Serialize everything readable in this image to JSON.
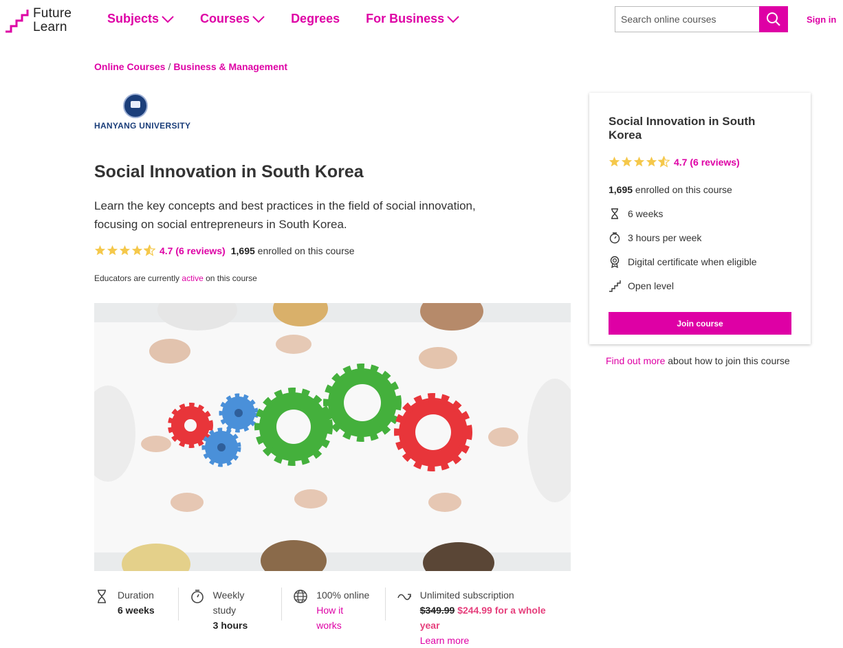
{
  "brand": {
    "line1": "Future",
    "line2": "Learn",
    "accent": "#de00a5"
  },
  "nav": [
    {
      "label": "Subjects",
      "has_menu": true
    },
    {
      "label": "Courses",
      "has_menu": true
    },
    {
      "label": "Degrees",
      "has_menu": false
    },
    {
      "label": "For Business",
      "has_menu": true
    }
  ],
  "search": {
    "placeholder": "Search online courses",
    "icon": "search-icon"
  },
  "signin": "Sign in",
  "breadcrumb": {
    "item1": "Online Courses",
    "sep": "/",
    "item2": "Business & Management"
  },
  "university": {
    "name": "HANYANG UNIVERSITY"
  },
  "course": {
    "title": "Social Innovation in South Korea",
    "description": "Learn the key concepts and best practices in the field of social innovation, focusing on social entrepreneurs in South Korea.",
    "rating": 4.7,
    "rating_text": "4.7 (6 reviews)",
    "enrolled_count": "1,695",
    "enrolled_suffix": " enrolled on this course",
    "educators_pre": "Educators are currently ",
    "educators_link": "active",
    "educators_post": " on this course"
  },
  "features": {
    "duration_label": "Duration",
    "duration_value": "6 weeks",
    "weekly_label1": "Weekly",
    "weekly_label2": "study",
    "weekly_value": "3 hours",
    "online_label": "100% online",
    "online_link1": "How it",
    "online_link2": "works",
    "sub_label": "Unlimited subscription",
    "sub_old_price": "$349.99",
    "sub_new_price": "$244.99 for a whole",
    "sub_new_price2": "year",
    "sub_link": "Learn more"
  },
  "card": {
    "title": "Social Innovation in South Korea",
    "rating_text": "4.7 (6 reviews)",
    "enrolled_count": "1,695",
    "enrolled_suffix": " enrolled on this course",
    "items": [
      {
        "icon": "hourglass-icon",
        "label": "6 weeks"
      },
      {
        "icon": "stopwatch-icon",
        "label": "3 hours per week"
      },
      {
        "icon": "certificate-icon",
        "label": "Digital certificate when eligible"
      },
      {
        "icon": "stairs-icon",
        "label": "Open level"
      }
    ],
    "join_label": "Join course",
    "findout_link": "Find out more",
    "findout_text": " about how to join this course"
  }
}
